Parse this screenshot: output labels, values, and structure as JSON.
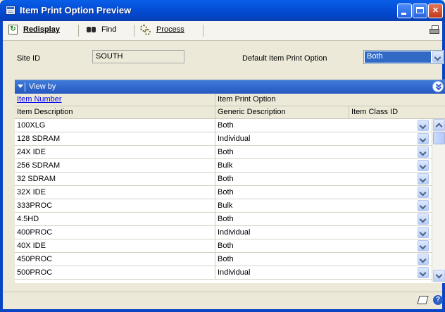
{
  "window": {
    "title": "Item Print Option Preview"
  },
  "toolbar": {
    "redisplay_label": "Redisplay",
    "find_label": "Find",
    "process_label": "Process"
  },
  "header": {
    "site_id_label": "Site ID",
    "site_id_value": "SOUTH",
    "default_option_label": "Default Item Print Option",
    "default_option_value": "Both"
  },
  "grid": {
    "view_by_label": "View by",
    "col_item_number": "Item Number",
    "col_item_print_option": "Item Print Option",
    "col_item_description": "Item Description",
    "col_generic_description": "Generic Description",
    "col_item_class_id": "Item Class ID",
    "rows": [
      {
        "item": "100XLG",
        "option": "Both"
      },
      {
        "item": "128 SDRAM",
        "option": "Individual"
      },
      {
        "item": "24X IDE",
        "option": "Both"
      },
      {
        "item": "256 SDRAM",
        "option": "Bulk"
      },
      {
        "item": "32 SDRAM",
        "option": "Both"
      },
      {
        "item": "32X IDE",
        "option": "Both"
      },
      {
        "item": "333PROC",
        "option": "Bulk"
      },
      {
        "item": "4.5HD",
        "option": "Both"
      },
      {
        "item": "400PROC",
        "option": "Individual"
      },
      {
        "item": "40X IDE",
        "option": "Both"
      },
      {
        "item": "450PROC",
        "option": "Both"
      },
      {
        "item": "500PROC",
        "option": "Individual"
      }
    ]
  },
  "icons": {
    "app": "window-app-icon",
    "redisplay": "redisplay-icon",
    "find": "binoculars-icon",
    "process": "gears-icon",
    "print": "printer-icon",
    "note": "note-icon",
    "help": "help-icon"
  },
  "colors": {
    "titlebar": "#0553dc",
    "selection": "#316ac5",
    "viewby_bar": "#2f67cc",
    "link": "#0000ee"
  }
}
